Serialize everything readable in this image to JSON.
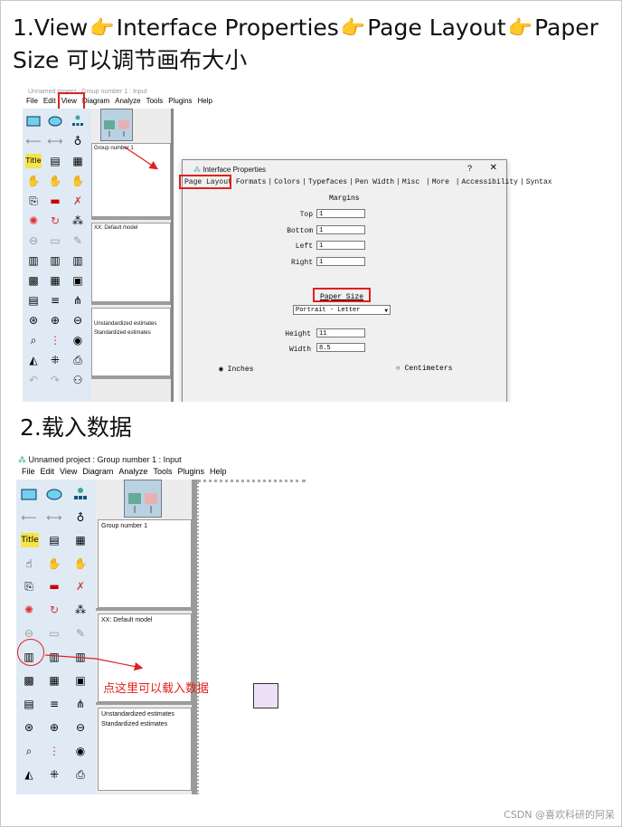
{
  "step1": {
    "heading_line1_parts": [
      "1.View",
      "Interface Properties",
      "Page Layout",
      "Paper"
    ],
    "heading_line2": "Size 可以调节画布大小",
    "hand_icon": "👉"
  },
  "screenshot1": {
    "title": "Unnamed project : Group number 1 : Input",
    "menu": [
      "File",
      "Edit",
      "View",
      "Diagram",
      "Analyze",
      "Tools",
      "Plugins",
      "Help"
    ],
    "panels": {
      "group": "Group number 1",
      "model": "XX: Default model",
      "estimates": [
        "Unstandardized estimates",
        "Standardized estimates"
      ]
    },
    "dialog": {
      "title": "Interface Properties",
      "help": "?",
      "close": "✕",
      "tabs": [
        "Page Layout",
        "Formats",
        "Colors",
        "Typefaces",
        "Pen Width",
        "Misc",
        "More",
        "Accessibility",
        "Syntax"
      ],
      "margins_title": "Margins",
      "margins": [
        {
          "label": "Top",
          "value": "1"
        },
        {
          "label": "Bottom",
          "value": "1"
        },
        {
          "label": "Left",
          "value": "1"
        },
        {
          "label": "Right",
          "value": "1"
        }
      ],
      "paper_size_title": "Paper Size",
      "paper_size_value": "Portrait - Letter",
      "height_label": "Height",
      "height_value": "11",
      "width_label": "Width",
      "width_value": "8.5",
      "unit_inches": "Inches",
      "unit_cm": "Centimeters"
    }
  },
  "step2": {
    "heading": "2.载入数据"
  },
  "screenshot2": {
    "title": "Unnamed project : Group number 1 : Input",
    "menu": [
      "File",
      "Edit",
      "View",
      "Diagram",
      "Analyze",
      "Tools",
      "Plugins",
      "Help"
    ],
    "panels": {
      "group": "Group number 1",
      "model": "XX: Default model",
      "estimates": [
        "Unstandardized estimates",
        "Standardized estimates"
      ]
    },
    "annotation": "点这里可以载入数据"
  },
  "watermark": "CSDN @喜欢科研的阿呆",
  "colors": {
    "annotation_red": "#e02020",
    "toolbox_bg": "#dfeaf5"
  },
  "icons": [
    "hand-pointing-right-icon",
    "rectangle-icon",
    "ellipse-icon",
    "indicator-icon",
    "arrow-left-icon",
    "double-arrow-icon",
    "unique-variable-icon",
    "title-icon",
    "list-variables-icon",
    "hand-select-icon",
    "truck-move-icon",
    "delete-x-icon",
    "gear-icon",
    "rotate-icon",
    "reflect-icon",
    "select-data-file-icon",
    "analysis-properties-icon",
    "calculate-estimates-icon",
    "save-icon",
    "zoom-in-icon",
    "zoom-out-icon",
    "binoculars-icon"
  ]
}
